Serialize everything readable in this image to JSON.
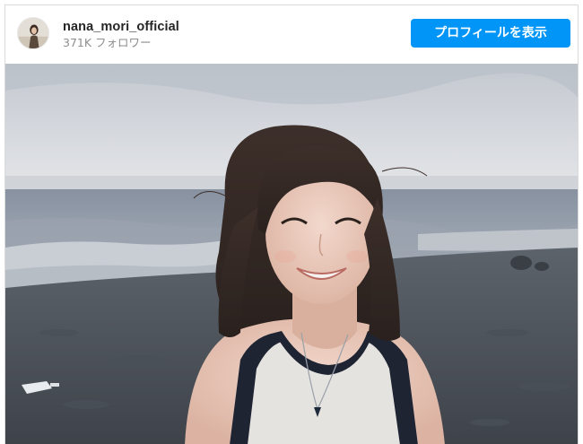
{
  "post": {
    "username": "nana_mori_official",
    "followers": "371K フォロワー",
    "profile_button_label": "プロフィールを表示",
    "avatar_icon": "profile-avatar",
    "image_icon": "post-photo"
  },
  "colors": {
    "accent": "#0095f6",
    "username": "#262626",
    "secondary_text": "#8e8e8e",
    "border": "#dbdbdb"
  }
}
